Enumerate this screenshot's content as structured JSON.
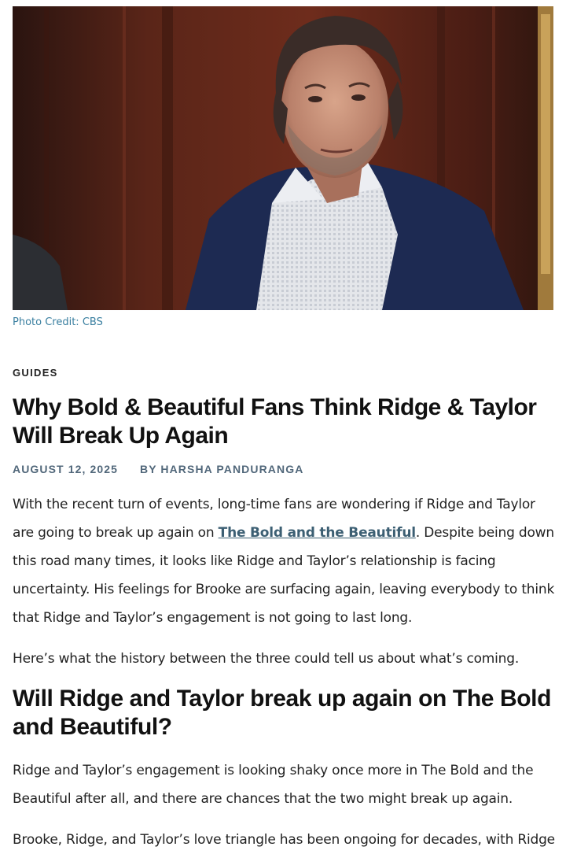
{
  "hero": {
    "image_alt": "Man in navy blazer and checked shirt in a wood-paneled room",
    "credit": "Photo Credit: CBS"
  },
  "article": {
    "category": "GUIDES",
    "title": "Why Bold & Beautiful Fans Think Ridge & Taylor Will Break Up Again",
    "date": "AUGUST 12, 2025",
    "author": "BY HARSHA PANDURANGA",
    "p1_before_link": "With the recent turn of events, long-time fans are wondering if Ridge and Taylor are going to break up again on ",
    "p1_link": "The Bold and the Beautiful",
    "p1_after_link": ". Despite being down this road many times, it looks like Ridge and Taylor’s relationship is facing uncertainty. His feelings for Brooke are surfacing again, leaving everybody to think that Ridge and Taylor’s engagement is not going to last long.",
    "p2": "Here’s what the history between the three could tell us about what’s coming.",
    "h2": "Will Ridge and Taylor break up again on The Bold and Beautiful?",
    "p3": "Ridge and Taylor’s engagement is looking shaky once more in The Bold and the Beautiful after all, and there are chances that the two might break up again.",
    "p4": "Brooke, Ridge, and Taylor’s love triangle has been ongoing for decades, with Ridge"
  }
}
